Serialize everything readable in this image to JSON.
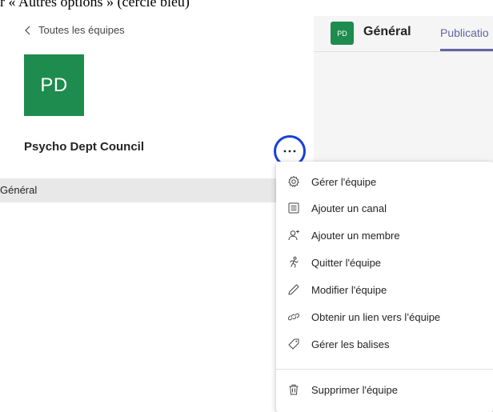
{
  "caption": "r « Autres options » (cercle bleu)",
  "left": {
    "back_label": "Toutes les équipes",
    "team_initials": "PD",
    "team_name": "Psycho Dept Council",
    "channel_general": "Général"
  },
  "header": {
    "initials": "PD",
    "channel_title": "Général",
    "tab_label": "Publicatio"
  },
  "menu": {
    "items": [
      {
        "label": "Gérer l'équipe",
        "icon": "gear-icon"
      },
      {
        "label": "Ajouter un canal",
        "icon": "channel-icon"
      },
      {
        "label": "Ajouter un membre",
        "icon": "add-person-icon"
      },
      {
        "label": "Quitter l'équipe",
        "icon": "leave-icon"
      },
      {
        "label": "Modifier l'équipe",
        "icon": "pencil-icon"
      },
      {
        "label": "Obtenir un lien vers l’équipe",
        "icon": "link-icon"
      },
      {
        "label": "Gérer les balises",
        "icon": "tag-icon"
      },
      {
        "label": "Supprimer l'équipe",
        "icon": "trash-icon"
      }
    ]
  },
  "colors": {
    "team_green": "#1e8c4e",
    "accent_purple": "#6264a7",
    "highlight_blue": "#1b3fd6"
  }
}
